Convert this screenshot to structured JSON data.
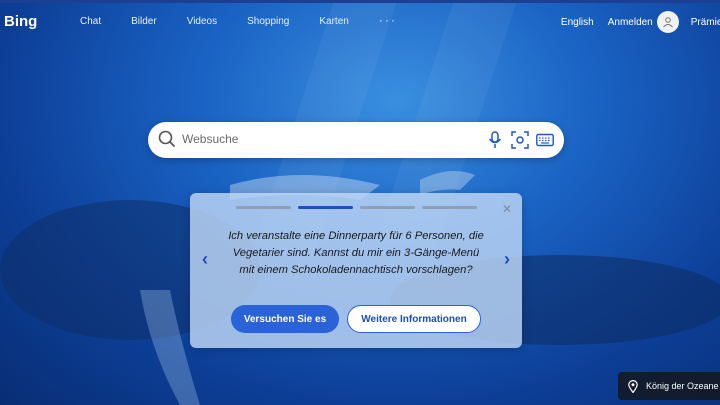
{
  "brand": {
    "logo_text": "Bing"
  },
  "nav": {
    "items": [
      {
        "label": "Chat"
      },
      {
        "label": "Bilder"
      },
      {
        "label": "Videos"
      },
      {
        "label": "Shopping"
      },
      {
        "label": "Karten"
      }
    ],
    "more_label": "···"
  },
  "header_right": {
    "language": "English",
    "signin": "Anmelden",
    "rewards": "Prämien"
  },
  "search": {
    "placeholder": "Websuche",
    "value": ""
  },
  "card": {
    "text": "Ich veranstalte eine Dinnerparty für 6 Personen, die Vegetarier sind. Kannst du mir ein 3-Gänge-Menü mit einem Schokoladennachtisch vorschlagen?",
    "primary_button": "Versuchen Sie es",
    "secondary_button": "Weitere Informationen",
    "close_label": "✕",
    "prev_label": "‹",
    "next_label": "›",
    "active_step": 2,
    "total_steps": 4
  },
  "caption": {
    "text": "König der Ozeane"
  },
  "colors": {
    "accent": "#2a62d8",
    "background": "#1a63c4"
  }
}
